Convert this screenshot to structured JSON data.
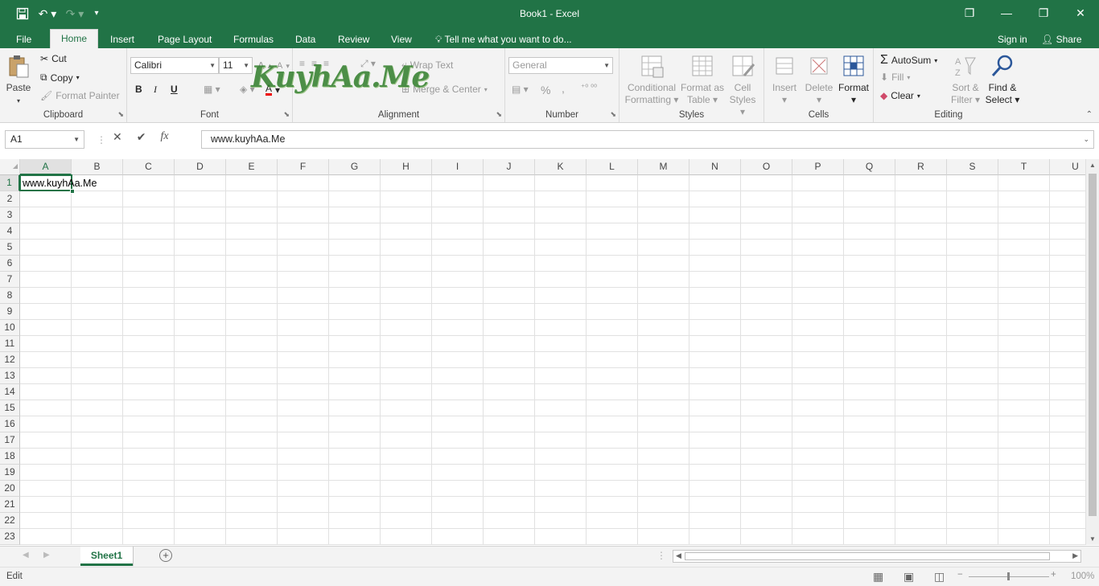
{
  "title": "Book1 - Excel",
  "qat": {
    "save_icon": "save-icon",
    "undo_icon": "undo-icon",
    "redo_icon": "redo-icon",
    "customize_icon": "customize-icon"
  },
  "window": {
    "ribbon_display": "❐",
    "minimize": "—",
    "restore": "❐",
    "close": "✕"
  },
  "tabs": [
    "File",
    "Home",
    "Insert",
    "Page Layout",
    "Formulas",
    "Data",
    "Review",
    "View"
  ],
  "tell_me": "Tell me what you want to do...",
  "sign_in": "Sign in",
  "share": "Share",
  "clipboard": {
    "paste": "Paste",
    "cut": "Cut",
    "copy": "Copy",
    "format_painter": "Format Painter",
    "label": "Clipboard"
  },
  "font": {
    "name": "Calibri",
    "size": "11",
    "bold": "B",
    "italic": "I",
    "underline": "U",
    "label": "Font"
  },
  "alignment": {
    "wrap_text": "Wrap Text",
    "merge_center": "Merge & Center",
    "label": "Alignment"
  },
  "number": {
    "format": "General",
    "percent": "%",
    "comma": ",",
    "label": "Number"
  },
  "styles": {
    "conditional_1": "Conditional",
    "conditional_2": "Formatting",
    "format_table_1": "Format as",
    "format_table_2": "Table",
    "cell_styles_1": "Cell",
    "cell_styles_2": "Styles",
    "label": "Styles"
  },
  "cells": {
    "insert": "Insert",
    "delete": "Delete",
    "format": "Format",
    "label": "Cells"
  },
  "editing": {
    "autosum": "AutoSum",
    "fill": "Fill",
    "clear": "Clear",
    "sort_1": "Sort &",
    "sort_2": "Filter",
    "find_1": "Find &",
    "find_2": "Select",
    "label": "Editing"
  },
  "watermark": "KuyhAa.Me",
  "formula_bar": {
    "name_box": "A1",
    "cancel": "✕",
    "enter": "✔",
    "fx": "fx",
    "value": "www.kuyhAa.Me"
  },
  "columns": [
    "A",
    "B",
    "C",
    "D",
    "E",
    "F",
    "G",
    "H",
    "I",
    "J",
    "K",
    "L",
    "M",
    "N",
    "O",
    "P",
    "Q",
    "R",
    "S",
    "T",
    "U"
  ],
  "rows": [
    "1",
    "2",
    "3",
    "4",
    "5",
    "6",
    "7",
    "8",
    "9",
    "10",
    "11",
    "12",
    "13",
    "14",
    "15",
    "16",
    "17",
    "18",
    "19",
    "20",
    "21",
    "22",
    "23"
  ],
  "cell_a1": "www.kuyhAa.Me",
  "sheet": {
    "name": "Sheet1",
    "add": "+"
  },
  "status": {
    "mode": "Edit",
    "zoom": "100%"
  },
  "colors": {
    "accent": "#217346",
    "ribbon_bg": "#f3f3f3"
  }
}
